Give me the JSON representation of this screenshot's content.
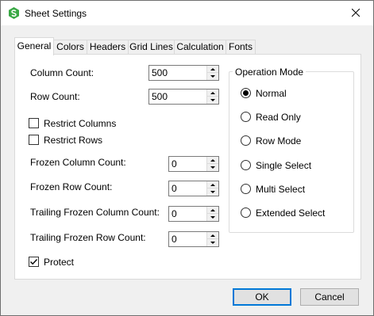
{
  "window": {
    "title": "Sheet Settings",
    "app_icon": "spread-app-icon",
    "close_icon": "close-icon",
    "accent_color": "#0078d7",
    "icon_color": "#3aa845"
  },
  "tabs": [
    {
      "label": "General",
      "active": true
    },
    {
      "label": "Colors",
      "active": false
    },
    {
      "label": "Headers",
      "active": false
    },
    {
      "label": "Grid Lines",
      "active": false
    },
    {
      "label": "Calculation",
      "active": false
    },
    {
      "label": "Fonts",
      "active": false
    }
  ],
  "general": {
    "column_count": {
      "label": "Column Count:",
      "value": "500"
    },
    "row_count": {
      "label": "Row Count:",
      "value": "500"
    },
    "restrict_columns": {
      "label": "Restrict Columns",
      "checked": false
    },
    "restrict_rows": {
      "label": "Restrict Rows",
      "checked": false
    },
    "frozen_column_count": {
      "label": "Frozen Column Count:",
      "value": "0"
    },
    "frozen_row_count": {
      "label": "Frozen Row Count:",
      "value": "0"
    },
    "trailing_frozen_column_count": {
      "label": "Trailing Frozen Column Count:",
      "value": "0"
    },
    "trailing_frozen_row_count": {
      "label": "Trailing Frozen Row Count:",
      "value": "0"
    },
    "protect": {
      "label": "Protect",
      "checked": true
    }
  },
  "operation_mode": {
    "title": "Operation Mode",
    "selected": "Normal",
    "options": [
      "Normal",
      "Read Only",
      "Row Mode",
      "Single Select",
      "Multi Select",
      "Extended Select"
    ]
  },
  "buttons": {
    "ok": "OK",
    "cancel": "Cancel"
  }
}
